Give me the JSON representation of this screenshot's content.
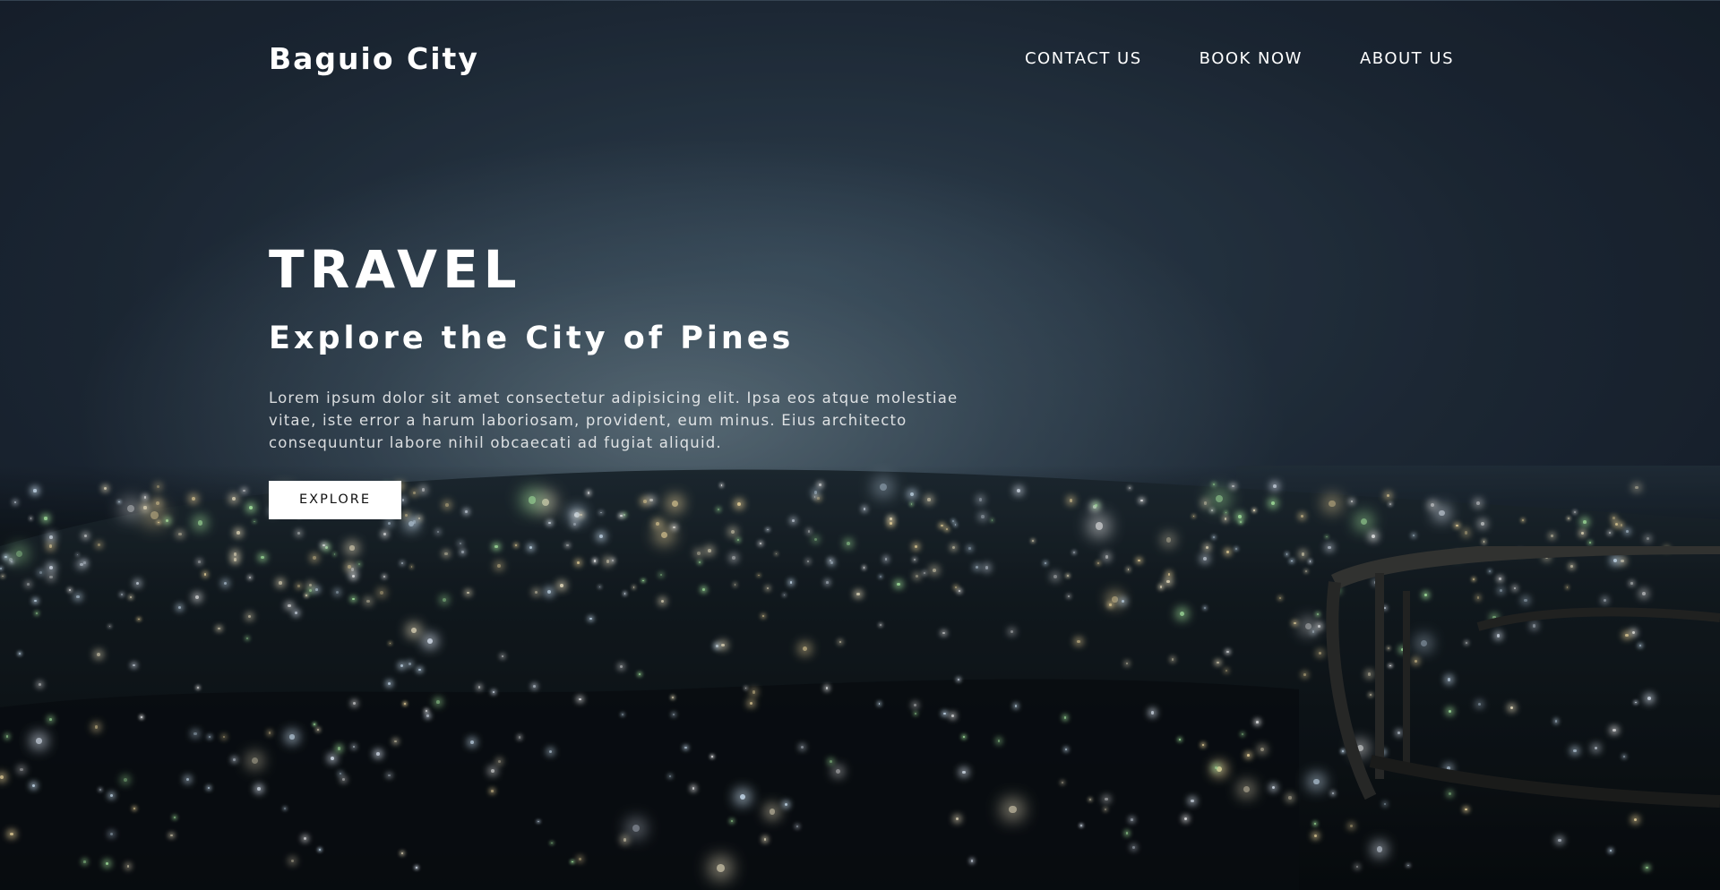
{
  "nav": {
    "brand": "Baguio City",
    "items": [
      {
        "label": "CONTACT US"
      },
      {
        "label": "BOOK NOW"
      },
      {
        "label": "ABOUT US"
      }
    ]
  },
  "hero": {
    "headline": "TRAVEL",
    "subheadline": "Explore the City of Pines",
    "body": "Lorem ipsum dolor sit amet consectetur adipisicing elit. Ipsa eos atque molestiae vitae, iste error a harum laboriosam, provident, eum minus. Eius architecto consequuntur labore nihil obcaecati ad fugiat aliquid.",
    "cta_label": "EXPLORE"
  },
  "colors": {
    "text": "#ffffff",
    "button_bg": "#ffffff",
    "button_text": "#111111"
  }
}
